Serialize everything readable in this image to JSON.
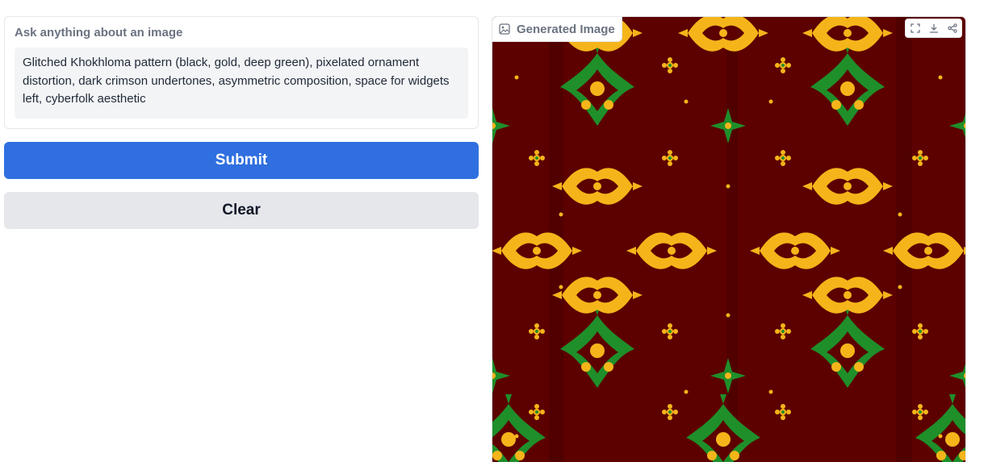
{
  "prompt": {
    "label": "Ask anything about an image",
    "value": "Glitched Khokhloma pattern (black, gold, deep green), pixelated ornament distortion, dark crimson undertones, asymmetric composition, space for widgets left, cyberfolk aesthetic"
  },
  "buttons": {
    "submit_label": "Submit",
    "clear_label": "Clear"
  },
  "output": {
    "label": "Generated Image",
    "label_icon": "image-icon",
    "toolbar_icons": [
      "fullscreen-icon",
      "download-icon",
      "share-icon"
    ]
  },
  "colors": {
    "accent": "#2f6fe0",
    "pattern_background": "#5c0000",
    "pattern_gold": "#f5b51a",
    "pattern_green": "#1f8f2a"
  }
}
